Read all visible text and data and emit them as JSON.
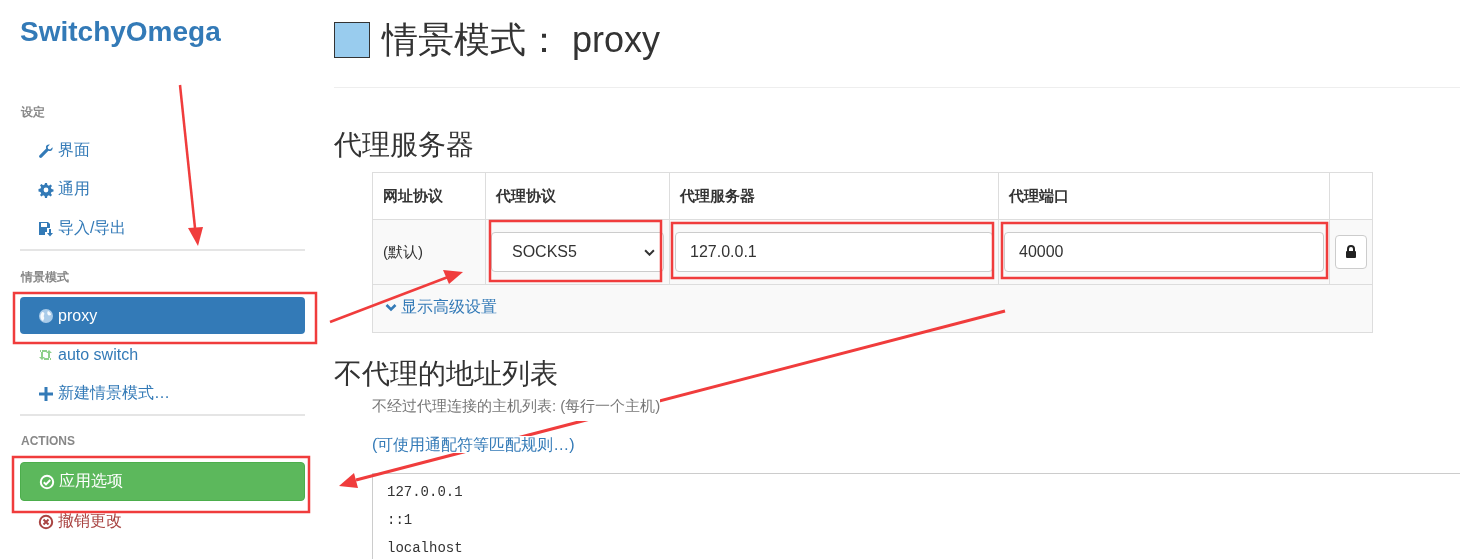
{
  "sidebar": {
    "title": "SwitchyOmega",
    "sections": [
      {
        "heading": "设定",
        "items": [
          {
            "label": "界面",
            "kind": "wrench",
            "selected": false
          },
          {
            "label": "通用",
            "kind": "gear",
            "selected": false
          },
          {
            "label": "导入/导出",
            "kind": "save",
            "selected": false
          }
        ]
      },
      {
        "heading": "情景模式",
        "items": [
          {
            "label": "proxy",
            "kind": "globe",
            "selected": true
          },
          {
            "label": "auto switch",
            "kind": "retweet",
            "selected": false
          },
          {
            "label": "新建情景模式…",
            "kind": "plus",
            "selected": false
          }
        ]
      },
      {
        "heading": "ACTIONS",
        "items": [
          {
            "label": "应用选项",
            "kind": "check-circle"
          },
          {
            "label": "撤销更改",
            "kind": "x-circle"
          }
        ]
      }
    ]
  },
  "profile": {
    "title": "情景模式： proxy",
    "color": "#99ccee"
  },
  "proxy_servers": {
    "heading": "代理服务器",
    "columns": [
      "网址协议",
      "代理协议",
      "代理服务器",
      "代理端口"
    ],
    "rows": [
      {
        "scheme": "(默认)",
        "protocol": "SOCKS5",
        "host": "127.0.0.1",
        "port": "40000"
      }
    ],
    "advanced_link": "显示高级设置"
  },
  "bypass": {
    "heading": "不代理的地址列表",
    "help": "不经过代理连接的主机列表: (每行一个主机)",
    "link": "(可使用通配符等匹配规则…)",
    "lines": [
      "127.0.0.1",
      "::1",
      "localhost"
    ]
  }
}
